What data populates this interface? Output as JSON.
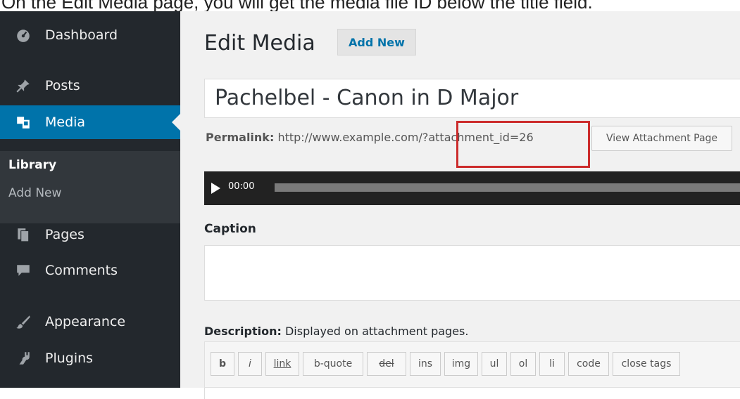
{
  "caption_text": "On the Edit Media page, you will get the media file ID below the title field.",
  "sidebar": {
    "items": [
      {
        "label": "Dashboard",
        "icon": "dashboard-icon"
      },
      {
        "label": "Posts",
        "icon": "pushpin-icon"
      },
      {
        "label": "Media",
        "icon": "media-icon",
        "active": true
      },
      {
        "label": "Pages",
        "icon": "pages-icon"
      },
      {
        "label": "Comments",
        "icon": "comment-icon"
      },
      {
        "label": "Appearance",
        "icon": "paintbrush-icon"
      },
      {
        "label": "Plugins",
        "icon": "plugin-icon"
      }
    ],
    "submenu": [
      {
        "label": "Library",
        "current": true
      },
      {
        "label": "Add New"
      }
    ]
  },
  "main": {
    "page_title": "Edit Media",
    "add_new_label": "Add New",
    "title_value": "Pachelbel - Canon in D Major",
    "permalink_label": "Permalink:",
    "permalink_url": "http://www.example.com/?attachment_id=26",
    "view_attachment_label": "View Attachment Page",
    "player_time": "00:00",
    "caption_label": "Caption",
    "description_label": "Description:",
    "description_hint": "Displayed on attachment pages.",
    "toolbar_buttons": [
      "b",
      "i",
      "link",
      "b-quote",
      "del",
      "ins",
      "img",
      "ul",
      "ol",
      "li",
      "code",
      "close tags"
    ]
  },
  "colors": {
    "sidebar_bg": "#23282d",
    "active_bg": "#0073aa",
    "highlight": "#cc2c2c",
    "link": "#0073aa"
  }
}
